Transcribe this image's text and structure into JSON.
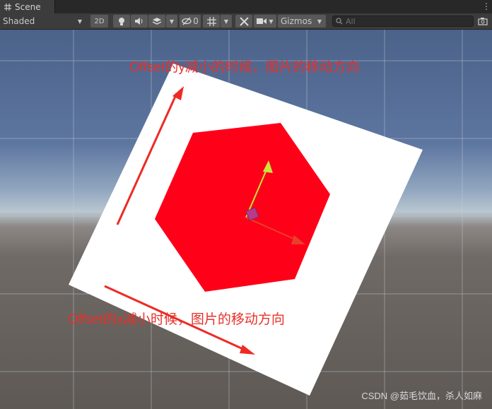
{
  "tab": {
    "label": "Scene",
    "icon": "grid-icon"
  },
  "toolbar": {
    "shading_mode": "Shaded",
    "mode_2d_label": "2D",
    "hidden_count": "0",
    "gizmos_label": "Gizmos",
    "search_placeholder": "All"
  },
  "annotations": {
    "y_offset": "Offset的y减小的时候，图片的移动方向",
    "x_offset": "Offset的x减小时候，图片的移动方向"
  },
  "colors": {
    "annotation": "#e8302a",
    "quad": "#ffffff",
    "hexagon": "#ff0019",
    "axis_x": "#e8402a",
    "axis_y": "#c8e63c"
  },
  "watermark": "CSDN @茹毛饮血，杀人如麻"
}
